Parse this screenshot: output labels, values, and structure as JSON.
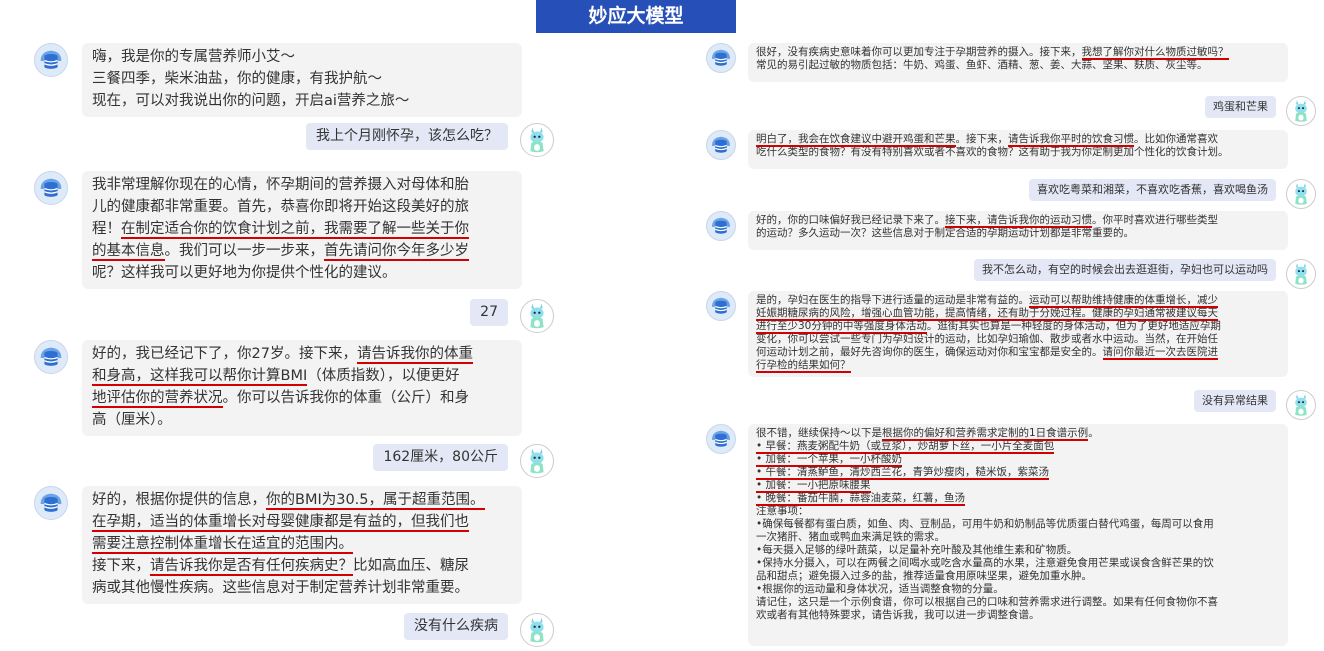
{
  "header": {
    "title": "妙应大模型"
  },
  "colors": {
    "banner": "#2650b8",
    "user_bubble": "#e4e8f6",
    "bot_bubble": "#f3f3f3",
    "underline": "#d40000"
  },
  "icons": {
    "assistant": "assistant-bot-icon",
    "user": "user-avatar-icon"
  },
  "left": [
    {
      "role": "bot",
      "lines": [
        [
          {
            "t": "嗨，我是你的专属营养师小艾～"
          }
        ],
        [
          {
            "t": "三餐四季，柴米油盐，你的健康，有我护航～"
          }
        ],
        [
          {
            "t": "现在，可以对我说出你的问题，开启ai营养之旅～"
          }
        ]
      ]
    },
    {
      "role": "user",
      "text": "我上个月刚怀孕，该怎么吃？"
    },
    {
      "role": "bot",
      "lines": [
        [
          {
            "t": "我非常理解你现在的心情，怀孕期间的营养摄入对母体和胎"
          }
        ],
        [
          {
            "t": "儿的健康都非常重要。首先，恭喜你即将开始这段美好的旅"
          }
        ],
        [
          {
            "t": "程！"
          },
          {
            "t": "在制定适合你的饮食计划之前，我需要了解一些关于你",
            "u": true
          }
        ],
        [
          {
            "t": "的基本信息",
            "u": true
          },
          {
            "t": "。我们可以一步一步来，"
          },
          {
            "t": "首先请问你今年多少岁",
            "u": true
          }
        ],
        [
          {
            "t": "呢？这样我可以更好地为你提供个性化的建议。"
          }
        ]
      ]
    },
    {
      "role": "user",
      "text": "27"
    },
    {
      "role": "bot",
      "lines": [
        [
          {
            "t": "好的，我已经记下了，你27岁。接下来，"
          },
          {
            "t": "请告诉我你的体重",
            "u": true
          }
        ],
        [
          {
            "t": "和身高，这样我可以帮你计算BMI",
            "u": true
          },
          {
            "t": "（体质指数），以便更好"
          }
        ],
        [
          {
            "t": "地评估你的营养状况",
            "u": true
          },
          {
            "t": "。你可以告诉我你的体重（公斤）和身"
          }
        ],
        [
          {
            "t": "高（厘米）。"
          }
        ]
      ]
    },
    {
      "role": "user",
      "text": "162厘米，80公斤"
    },
    {
      "role": "bot",
      "lines": [
        [
          {
            "t": "好的，根据你提供的信息，"
          },
          {
            "t": "你的BMI为30.5，属于超重范围。",
            "u": true
          }
        ],
        [
          {
            "t": "在孕期，适当的体重增长对母婴健康都是有益的，但我们也",
            "u": true
          }
        ],
        [
          {
            "t": "需要注意控制体重增长在适宜的范围内。",
            "u": true
          }
        ],
        [
          {
            "t": "接下来，"
          },
          {
            "t": "请告诉我你是否有任何疾病史？",
            "u": true
          },
          {
            "t": "比如高血压、糖尿"
          }
        ],
        [
          {
            "t": "病或其他慢性疾病。这些信息对于制定营养计划非常重要。"
          }
        ]
      ]
    },
    {
      "role": "user",
      "text": "没有什么疾病"
    }
  ],
  "right": [
    {
      "role": "bot",
      "lines": [
        [
          {
            "t": "很好，没有疾病史意味着你可以更加专注于孕期营养的摄入。接下来，"
          },
          {
            "t": "我想了解你对什么物质过敏吗？",
            "u": true
          }
        ],
        [
          {
            "t": "常见的易引起过敏的物质包括：牛奶、鸡蛋、鱼虾、酒精、葱、姜、大蒜、坚果、麸质、灰尘等。"
          }
        ]
      ]
    },
    {
      "role": "user",
      "text": "鸡蛋和芒果"
    },
    {
      "role": "bot",
      "lines": [
        [
          {
            "t": "明白了，我会在饮食建议中避开鸡蛋和芒果",
            "u": true
          },
          {
            "t": "。接下来，"
          },
          {
            "t": "请告诉我你平时的饮食习惯",
            "u": true
          },
          {
            "t": "。比如你通常喜欢"
          }
        ],
        [
          {
            "t": "吃什么类型的食物？有没有特别喜欢或者不喜欢的食物？这有助于我为你定制更加个性化的饮食计划。"
          }
        ]
      ]
    },
    {
      "role": "user",
      "text": "喜欢吃粤菜和湘菜，不喜欢吃香蕉，喜欢喝鱼汤"
    },
    {
      "role": "bot",
      "lines": [
        [
          {
            "t": "好的，你的口味偏好我已经记录下来了。"
          },
          {
            "t": "接下来，请告诉我你的运动习惯",
            "u": true
          },
          {
            "t": "。你平时喜欢进行哪些类型"
          }
        ],
        [
          {
            "t": "的运动？多久运动一次？这些信息对于制定合适的孕期运动计划都是非常重要的。"
          }
        ]
      ]
    },
    {
      "role": "user",
      "text": "我不怎么动，有空的时候会出去逛逛街，孕妇也可以运动吗"
    },
    {
      "role": "bot",
      "lines": [
        [
          {
            "t": "是的，孕妇在医生的指导下进行适量的运动是非常有益的。"
          },
          {
            "t": "运动可以帮助维持健康的体重增长，减少",
            "u": true
          }
        ],
        [
          {
            "t": "妊娠期糖尿病的风险，增强心血管功能，提高情绪，还有助于分娩过程。健康的孕妇通常被建议每天",
            "u": true
          }
        ],
        [
          {
            "t": "进行至少30分钟的中等强度身体活动",
            "u": true
          },
          {
            "t": "。逛街其实也算是一种轻度的身体活动，但为了更好地适应孕期"
          }
        ],
        [
          {
            "t": "变化，你可以尝试一些专门为孕妇设计的运动，比如孕妇瑜伽、散步或者水中运动。当然，在开始任"
          }
        ],
        [
          {
            "t": "何运动计划之前，最好先咨询你的医生，确保运动对你和宝宝都是安全的。"
          },
          {
            "t": "请问你最近一次去医院进",
            "u": true
          }
        ],
        [
          {
            "t": "行孕检的结果如何？",
            "u": true
          }
        ]
      ]
    },
    {
      "role": "user",
      "text": "没有异常结果"
    },
    {
      "role": "bot",
      "lines": [
        [
          {
            "t": "很不错，继续保持～以下是"
          },
          {
            "t": "根据你的偏好和营养需求定制的1日食谱示例",
            "u": true
          },
          {
            "t": "。"
          }
        ],
        [
          {
            "t": "• 早餐：燕麦粥配牛奶（或豆浆），炒胡萝卜丝，一小片全麦面包",
            "u": true
          }
        ],
        [
          {
            "t": "• 加餐：一个苹果，一小杯酸奶",
            "u": true
          }
        ],
        [
          {
            "t": "• 午餐：清蒸鲈鱼，清炒西兰花，青笋炒瘦肉，糙米饭，紫菜汤",
            "u": true
          }
        ],
        [
          {
            "t": "• 加餐：一小把原味腰果",
            "u": true
          }
        ],
        [
          {
            "t": "• 晚餐：番茄牛腩，蒜蓉油麦菜，红薯，鱼汤",
            "u": true
          }
        ],
        [
          {
            "t": "注意事项："
          }
        ],
        [
          {
            "t": "•确保每餐都有蛋白质，如鱼、肉、豆制品，可用牛奶和奶制品等优质蛋白替代鸡蛋，每周可以食用"
          }
        ],
        [
          {
            "t": "一次猪肝、猪血或鸭血来满足铁的需求。"
          }
        ],
        [
          {
            "t": "•每天摄入足够的绿叶蔬菜，以足量补充叶酸及其他维生素和矿物质。"
          }
        ],
        [
          {
            "t": "•保持水分摄入，可以在两餐之间喝水或吃含水量高的水果，注意避免食用芒果或误食含鲜芒果的饮"
          }
        ],
        [
          {
            "t": "品和甜点；避免摄入过多的盐，推荐适量食用原味坚果，避免加重水肿。"
          }
        ],
        [
          {
            "t": "•根据你的运动量和身体状况，适当调整食物的分量。"
          }
        ],
        [
          {
            "t": "请记住，这只是一个示例食谱，你可以根据自己的口味和营养需求进行调整。如果有任何食物你不喜"
          }
        ],
        [
          {
            "t": "欢或者有其他特殊要求，请告诉我，我可以进一步调整食谱。"
          }
        ]
      ]
    }
  ]
}
